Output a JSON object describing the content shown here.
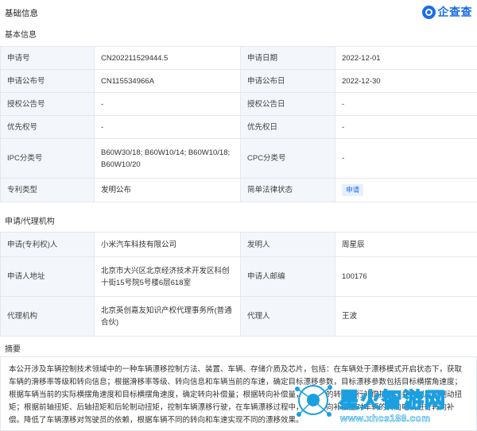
{
  "header": {
    "title": "基础信息",
    "logo_text": "企查查"
  },
  "sections": {
    "basic": "基本信息",
    "applicant": "申请/代理机构",
    "abstract": "摘要"
  },
  "basic_rows": [
    {
      "k1": "申请号",
      "v1": "CN202211529444.5",
      "k2": "申请日期",
      "v2": "2022-12-01"
    },
    {
      "k1": "申请公布号",
      "v1": "CN115534966A",
      "k2": "申请公布日",
      "v2": "2022-12-30"
    },
    {
      "k1": "授权公告号",
      "v1": "-",
      "k2": "授权公告日",
      "v2": "-"
    },
    {
      "k1": "优先权号",
      "v1": "-",
      "k2": "优先权日",
      "v2": "-"
    },
    {
      "k1": "IPC分类号",
      "v1": "B60W30/18; B60W10/14; B60W10/18; B60W10/20",
      "k2": "CPC分类号",
      "v2": "-"
    },
    {
      "k1": "专利类型",
      "v1": "发明公布",
      "k2": "简单法律状态",
      "v2": "申请"
    }
  ],
  "applicant_rows": [
    {
      "k1": "申请(专利权)人",
      "v1": "小米汽车科技有限公司",
      "k2": "发明人",
      "v2": "周星辰"
    },
    {
      "k1": "申请人地址",
      "v1": "北京市大兴区北京经济技术开发区科创十街15号院5号楼6层618室",
      "k2": "申请人邮编",
      "v2": "100176"
    },
    {
      "k1": "代理机构",
      "v1": "北京英创嘉友知识产权代理事务所(普通合伙)",
      "k2": "代理人",
      "v2": "王波"
    }
  ],
  "abstract_text": "本公开涉及车辆控制技术领域中的一种车辆漂移控制方法、装置、车辆、存储介质及芯片，包括：在车辆处于漂移模式开启状态下，获取车辆的滑移率等级和转向信息；根据滑移率等级、转向信息和车辆当前的车速，确定目标漂移参数，目标漂移参数包括目标横摆角速度；根据车辆当前的实际横摆角速度和目标横摆角速度，确定转向补偿量；根据转向补偿量，对车辆的转向进行补偿控制，并控制后轮制动扭矩；根据前轴扭矩、后轴扭矩和后轮制动扭矩，控制车辆漂移行驶，在车辆漂移过程中，根据转向补偿量对车辆的转向电机进行转向补偿。降低了车辆漂移对驾驶员的依赖，根据车辆不同的转向和车速实现不同的漂移效果。",
  "watermark": {
    "name": "星火智游网",
    "url": "www.xhcs188.com"
  },
  "colors": {
    "accent": "#1a6ee8",
    "key_bg": "#f3f6fa",
    "border": "#e4e8ee"
  }
}
